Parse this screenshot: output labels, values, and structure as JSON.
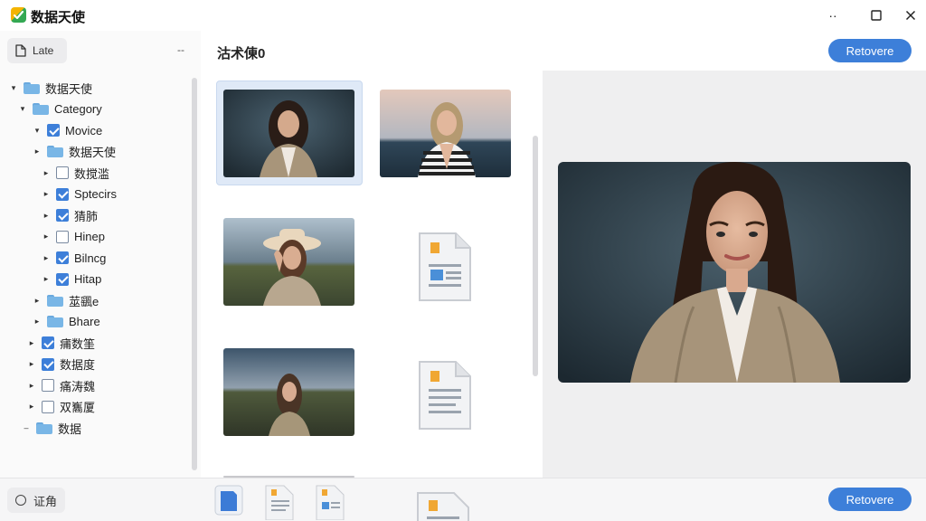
{
  "app": {
    "title": "数据天使"
  },
  "window": {
    "min_label": "··",
    "max_label": "☐",
    "close_label": "✕"
  },
  "sidebar": {
    "late_label": "Late",
    "dash_label": "--",
    "tree": [
      {
        "label": "数据天使",
        "chevron": "▾",
        "kind": "folder"
      },
      {
        "label": "Category",
        "chevron": "▾",
        "kind": "folder"
      },
      {
        "label": "Movice",
        "chevron": "▾",
        "kind": "checkbox",
        "checked": true
      },
      {
        "label": "数据天使",
        "chevron": "▸",
        "kind": "folder"
      },
      {
        "label": "数搅滥",
        "chevron": "▸",
        "kind": "checkbox",
        "checked": false
      },
      {
        "label": "Sptecirs",
        "chevron": "▸",
        "kind": "checkbox",
        "checked": true
      },
      {
        "label": "猜肺",
        "chevron": "▸",
        "kind": "checkbox",
        "checked": true
      },
      {
        "label": "Hinep",
        "chevron": "▸",
        "kind": "checkbox",
        "checked": false
      },
      {
        "label": "Bilncg",
        "chevron": "▸",
        "kind": "checkbox",
        "checked": true
      },
      {
        "label": "Hitap",
        "chevron": "▸",
        "kind": "checkbox",
        "checked": true
      },
      {
        "label": "莁颻e",
        "chevron": "▸",
        "kind": "folder"
      },
      {
        "label": "Bhare",
        "chevron": "▸",
        "kind": "folder"
      },
      {
        "label": "痡数筀",
        "chevron": "▸",
        "kind": "checkbox",
        "checked": true
      },
      {
        "label": "数据度",
        "chevron": "▸",
        "kind": "checkbox",
        "checked": true
      },
      {
        "label": "痛涛魏",
        "chevron": "▸",
        "kind": "checkbox",
        "checked": false
      },
      {
        "label": "双雟厦",
        "chevron": "▸",
        "kind": "checkbox",
        "checked": false
      },
      {
        "label": "数据",
        "chevron": "–",
        "kind": "folder"
      }
    ]
  },
  "main": {
    "title": "沽术倲0",
    "recover_label": "Retovere"
  },
  "bottom": {
    "left_label": "证角",
    "recover_label": "Retovere"
  },
  "colors": {
    "accent": "#3d7fd9",
    "folder": "#79b6e6",
    "selected_bg": "#dfe9f7"
  }
}
